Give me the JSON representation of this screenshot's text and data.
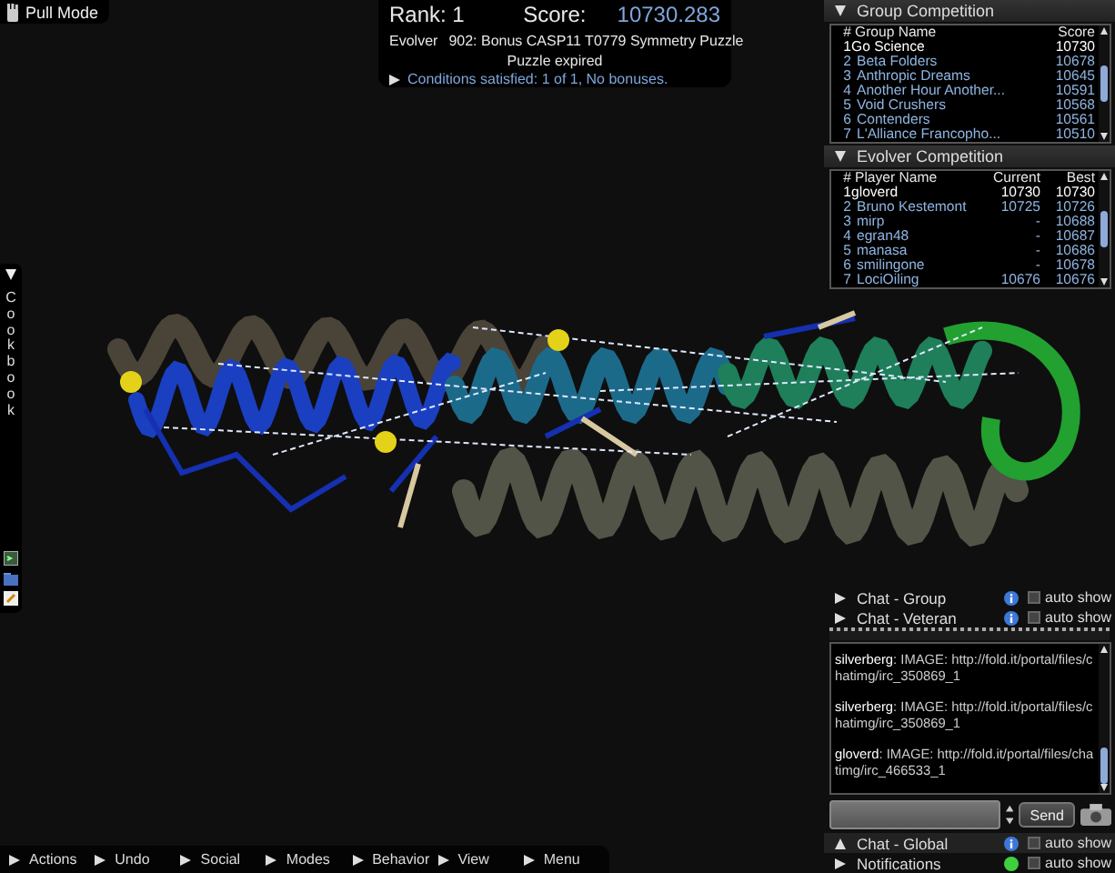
{
  "pull_mode": {
    "label": "Pull Mode"
  },
  "score_panel": {
    "rank": "Rank: 1",
    "score_label": "Score:",
    "score": "10730.283",
    "mode": "Evolver",
    "puzzle": "902: Bonus CASP11 T0779 Symmetry Puzzle",
    "status": "Puzzle expired",
    "conditions": {
      "text": "Conditions satisfied: 1 of 1, No bonuses.",
      "expanded": false
    }
  },
  "cookbook": {
    "label": "Cookbook",
    "expanded": true
  },
  "group_competition": {
    "title": "Group Competition",
    "expanded": true,
    "columns": [
      "#",
      "Group Name",
      "Score"
    ],
    "rows": [
      {
        "rank": "1",
        "name": "Go Science",
        "score": "10730",
        "selected": true
      },
      {
        "rank": "2",
        "name": "Beta Folders",
        "score": "10678",
        "selected": false
      },
      {
        "rank": "3",
        "name": "Anthropic Dreams",
        "score": "10645",
        "selected": false
      },
      {
        "rank": "4",
        "name": "Another Hour Another...",
        "score": "10591",
        "selected": false
      },
      {
        "rank": "5",
        "name": "Void Crushers",
        "score": "10568",
        "selected": false
      },
      {
        "rank": "6",
        "name": "Contenders",
        "score": "10561",
        "selected": false
      },
      {
        "rank": "7",
        "name": "L'Alliance Francopho...",
        "score": "10510",
        "selected": false
      }
    ]
  },
  "evolver_competition": {
    "title": "Evolver Competition",
    "expanded": true,
    "columns": [
      "#",
      "Player Name",
      "Current",
      "Best"
    ],
    "rows": [
      {
        "rank": "1",
        "name": "gloverd",
        "current": "10730",
        "best": "10730",
        "selected": true
      },
      {
        "rank": "2",
        "name": "Bruno Kestemont",
        "current": "10725",
        "best": "10726",
        "selected": false
      },
      {
        "rank": "3",
        "name": "mirp",
        "current": "-",
        "best": "10688",
        "selected": false
      },
      {
        "rank": "4",
        "name": "egran48",
        "current": "-",
        "best": "10687",
        "selected": false
      },
      {
        "rank": "5",
        "name": "manasa",
        "current": "-",
        "best": "10686",
        "selected": false
      },
      {
        "rank": "6",
        "name": "smilingone",
        "current": "-",
        "best": "10678",
        "selected": false
      },
      {
        "rank": "7",
        "name": "LociOiling",
        "current": "10676",
        "best": "10676",
        "selected": false
      }
    ]
  },
  "chat_channels": [
    {
      "label": "Chat - Group",
      "expanded": false,
      "kind": "info",
      "auto_show": false,
      "auto_show_label": "auto show"
    },
    {
      "label": "Chat - Veteran",
      "expanded": false,
      "kind": "info",
      "auto_show": false,
      "auto_show_label": "auto show"
    }
  ],
  "chat_log": [
    {
      "text": "**silverberg**: IMAGE: http://fold.it/portal/files/chatimg/irc_350869_1"
    },
    {
      "text": "**silverberg**: IMAGE: http://fold.it/portal/files/chatimg/irc_350869_1"
    },
    {
      "text": "**gloverd**: IMAGE: http://fold.it/portal/files/chatimg/irc_466533_1"
    }
  ],
  "chat_input": {
    "send": "Send"
  },
  "chat_panels": [
    {
      "label": "Chat - Global",
      "expanded": true,
      "kind": "info",
      "auto_show": false,
      "auto_show_label": "auto show"
    },
    {
      "label": "Notifications",
      "expanded": false,
      "kind": "online",
      "auto_show": false,
      "auto_show_label": "auto show"
    }
  ],
  "menu_bar": [
    {
      "label": "Actions"
    },
    {
      "label": "Undo"
    },
    {
      "label": "Social"
    },
    {
      "label": "Modes"
    },
    {
      "label": "Behavior"
    },
    {
      "label": "View"
    },
    {
      "label": "Menu"
    }
  ]
}
